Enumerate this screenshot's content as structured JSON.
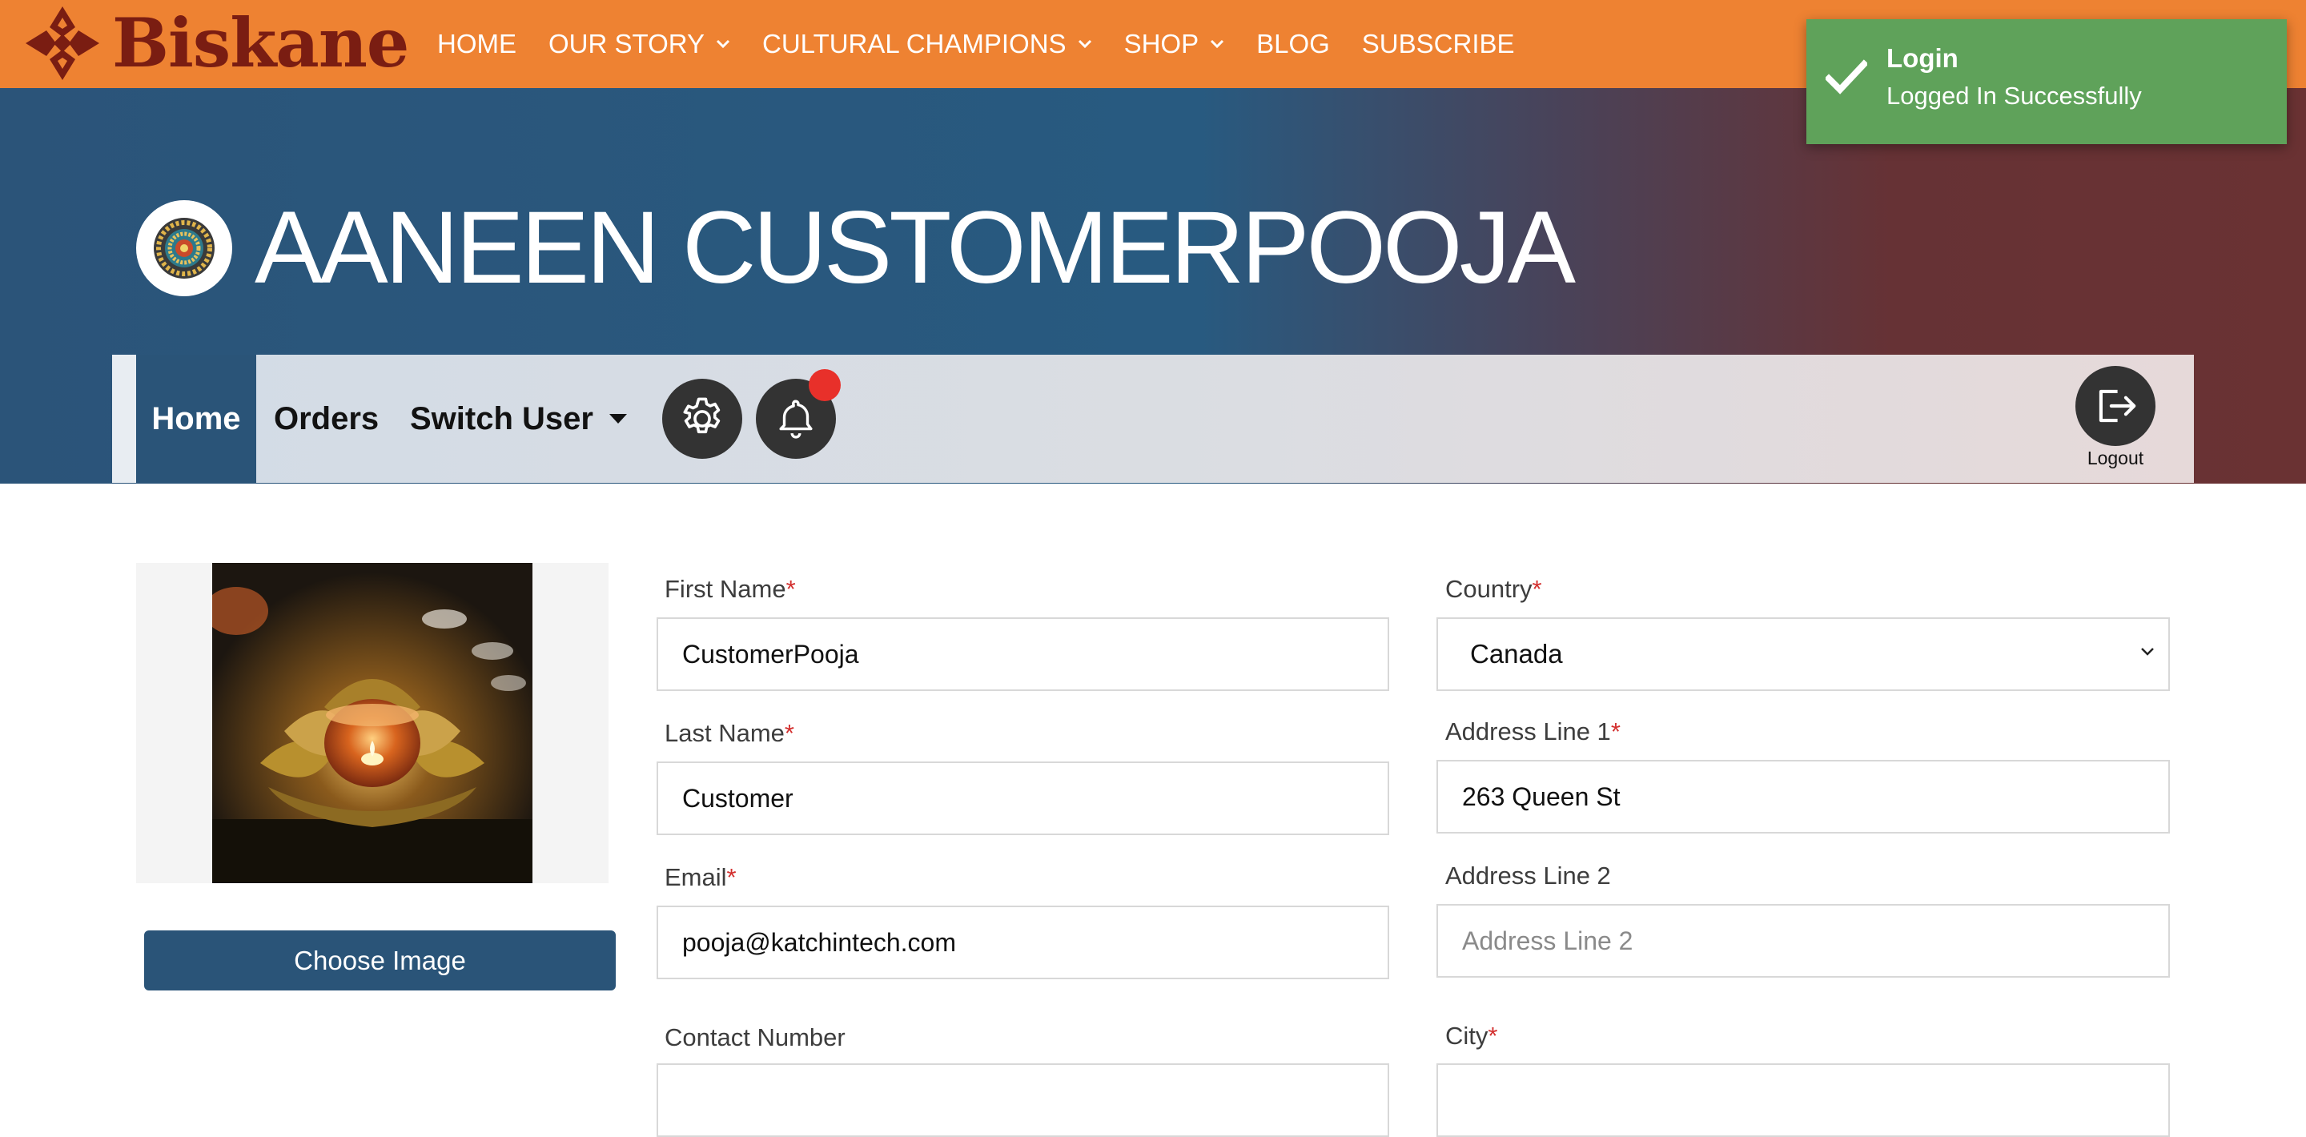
{
  "header": {
    "brand": "Biskane",
    "nav": [
      {
        "label": "HOME",
        "has_dropdown": false
      },
      {
        "label": "OUR STORY",
        "has_dropdown": true
      },
      {
        "label": "CULTURAL CHAMPIONS",
        "has_dropdown": true
      },
      {
        "label": "SHOP",
        "has_dropdown": true
      },
      {
        "label": "BLOG",
        "has_dropdown": false
      },
      {
        "label": "SUBSCRIBE",
        "has_dropdown": false
      }
    ]
  },
  "toast": {
    "title": "Login",
    "message": "Logged In Successfully",
    "icon": "check-icon"
  },
  "profile": {
    "name": "AANEEN CUSTOMERPOOJA",
    "avatar_icon": "medallion-avatar"
  },
  "subnav": {
    "tabs": {
      "home": "Home",
      "orders": "Orders",
      "switch_user": "Switch User"
    },
    "active_tab": "Home",
    "settings_icon": "gear-icon",
    "notifications_icon": "bell-icon",
    "logout_label": "Logout"
  },
  "image_panel": {
    "choose_label": "Choose Image",
    "photo_alt": "lotus-candle-holder-photo"
  },
  "form": {
    "first_name": {
      "label": "First Name",
      "required": "*",
      "value": "CustomerPooja"
    },
    "last_name": {
      "label": "Last Name",
      "required": "*",
      "value": "Customer"
    },
    "email": {
      "label": "Email",
      "required": "*",
      "value": "pooja@katchintech.com"
    },
    "contact_number": {
      "label": "Contact Number"
    },
    "country": {
      "label": "Country",
      "required": "*",
      "value": "Canada"
    },
    "address1": {
      "label": "Address Line 1",
      "required": "*",
      "value": "263 Queen St"
    },
    "address2": {
      "label": "Address Line 2",
      "placeholder": "Address Line 2",
      "value": ""
    },
    "city": {
      "label": "City",
      "required": "*"
    }
  },
  "colors": {
    "brand_orange": "#ee8232",
    "brand_dark": "#7a1d12",
    "primary_blue": "#2a5478",
    "toast_green": "#5fa25a",
    "required_red": "#d3302f"
  }
}
